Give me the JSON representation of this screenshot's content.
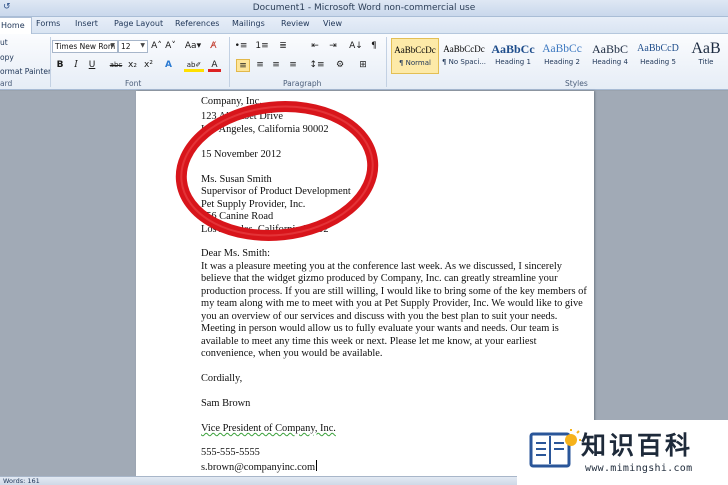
{
  "window": {
    "title": "Document1 - Microsoft Word non-commercial use",
    "quick_access_glyph": "↺"
  },
  "tabs": [
    "Home",
    "Forms",
    "Insert",
    "Page Layout",
    "References",
    "Mailings",
    "Review",
    "View"
  ],
  "active_tab": "Home",
  "ribbon": {
    "clipboard": {
      "cut": "ut",
      "copy": "opy",
      "painter": "ormat Painter",
      "label": "ard"
    },
    "font": {
      "name": "Times New Rom",
      "size": "12",
      "grow": "A˄",
      "shrink": "A˅",
      "change_case": "Aa▾",
      "clear_format": "A̸",
      "bold": "B",
      "italic": "I",
      "underline": "U",
      "strikethrough": "abc",
      "subscript": "x₂",
      "superscript": "x²",
      "effects": "A",
      "highlight": "ab✐",
      "font_color": "A",
      "label": "Font"
    },
    "paragraph": {
      "bullets": "•≡",
      "numbering": "1≡",
      "multilevel": "≣",
      "decrease_indent": "⇤",
      "increase_indent": "⇥",
      "sort": "A↓",
      "show_marks": "¶",
      "align_left": "≡",
      "center": "≡",
      "align_right": "≡",
      "justify": "≡",
      "line_spacing": "↕≡",
      "shading": "⚙",
      "borders": "⊞",
      "label": "Paragraph"
    },
    "styles": {
      "items": [
        {
          "sample": "AaBbCcDc",
          "name": "¶ Normal"
        },
        {
          "sample": "AaBbCcDc",
          "name": "¶ No Spaci..."
        },
        {
          "sample": "AaBbCc",
          "name": "Heading 1"
        },
        {
          "sample": "AaBbCc",
          "name": "Heading 2"
        },
        {
          "sample": "AaBbC",
          "name": "Heading 4"
        },
        {
          "sample": "AaBbCcD",
          "name": "Heading 5"
        },
        {
          "sample": "AaB",
          "name": "Title"
        }
      ],
      "label": "Styles"
    }
  },
  "document": {
    "lines": [
      "Company, Inc.",
      "123 Alphabet Drive",
      "Los Angeles, California 90002",
      "15 November 2012",
      "Ms. Susan Smith",
      "Supervisor of Product Development",
      "Pet Supply Provider, Inc.",
      "456 Canine Road",
      "Los Angeles, California 90002",
      "Dear Ms. Smith:",
      "It was a pleasure meeting you at the conference last week. As we discussed, I sincerely",
      "believe that the widget gizmo produced by Company, Inc. can greatly streamline your",
      "production process. If you are still willing, I would like to bring some of the key members of",
      "my team along with me to meet with you at Pet Supply Provider, Inc. We would like to give",
      "you an overview of our services and discuss with you the best plan to suit your needs.",
      "Meeting in person would allow us to fully evaluate your wants and needs. Our team is",
      "available to meet any time this week or next. Please let me know, at your earliest",
      "convenience, when you would be available.",
      "Cordially,",
      "Sam Brown",
      "Vice President of Company, Inc.",
      "555-555-5555",
      "s.brown@companyinc.com"
    ]
  },
  "status": {
    "words": "Words: 161"
  },
  "watermark": {
    "chinese": "知识百科",
    "url": "www.mimingshi.com"
  },
  "colors": {
    "marker_red": "#d8151b",
    "accent_blue": "#2a5699"
  }
}
